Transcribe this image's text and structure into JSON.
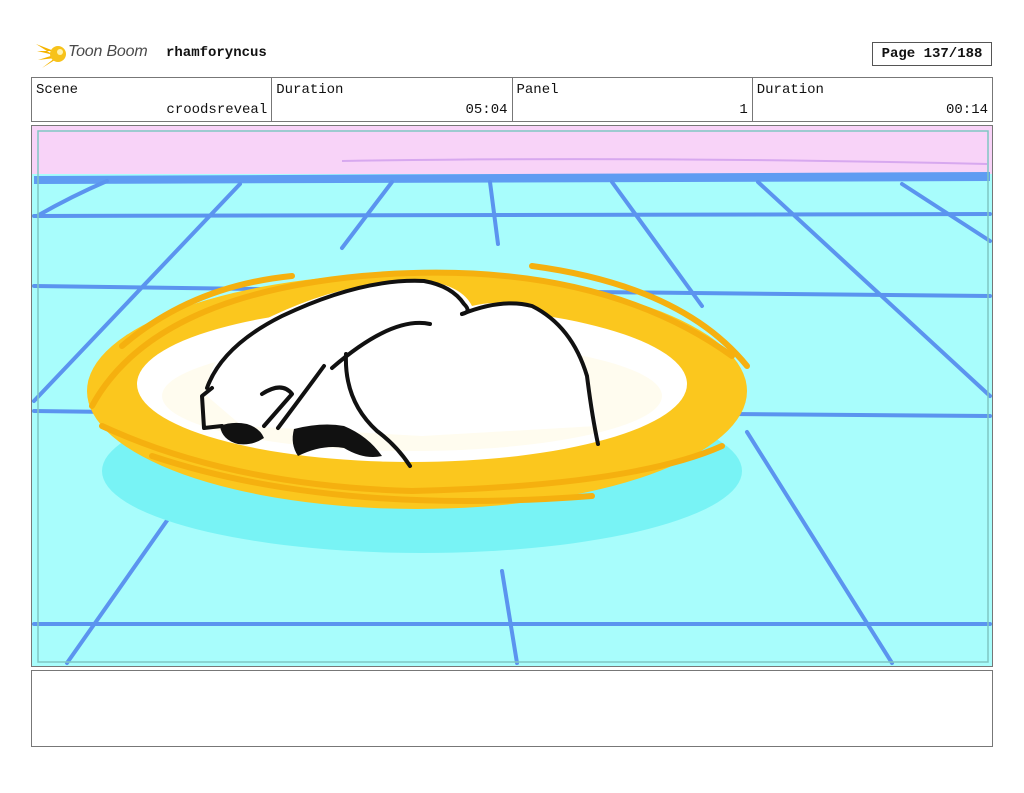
{
  "header": {
    "logo_text": "Toon Boom",
    "project_name": "rhamforyncus",
    "page_indicator": "Page 137/188"
  },
  "info": {
    "scene_label": "Scene",
    "scene_value": "croodsreveal",
    "scene_duration_label": "Duration",
    "scene_duration_value": "05:04",
    "panel_label": "Panel",
    "panel_value": "1",
    "panel_duration_label": "Duration",
    "panel_duration_value": "00:14"
  },
  "notes": {
    "text": ""
  }
}
